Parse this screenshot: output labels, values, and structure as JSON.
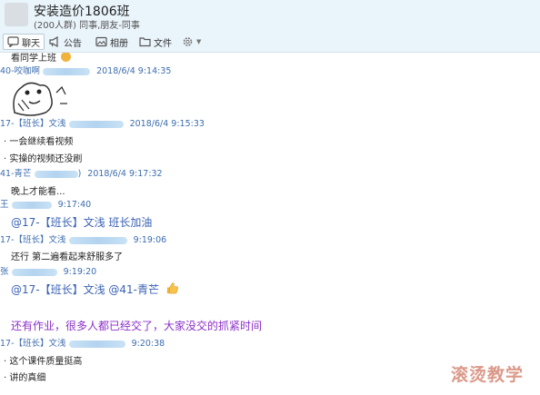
{
  "header": {
    "title": "安装造价1806班",
    "subtitle": "(200人群) 同事,朋友-同事"
  },
  "toolbar": {
    "items": [
      {
        "label": "聊天",
        "icon": "chat-icon"
      },
      {
        "label": "公告",
        "icon": "announcement-icon"
      },
      {
        "label": "相册",
        "icon": "album-icon"
      },
      {
        "label": "文件",
        "icon": "folder-icon"
      },
      {
        "label": "",
        "icon": "gear-icon"
      }
    ]
  },
  "messages": [
    {
      "type": "text",
      "text": "看同学上班"
    },
    {
      "type": "meta",
      "sender": "40-咬咖啊",
      "time": "2018/6/4 9:14:35"
    },
    {
      "type": "meta",
      "sender": "17-【班长】文浅",
      "time": "2018/6/4 9:15:33"
    },
    {
      "type": "text",
      "text": "一会继续看视频"
    },
    {
      "type": "text",
      "text": "实操的视频还没刷"
    },
    {
      "type": "meta",
      "sender": "41-青芒",
      "time": "2018/6/4 9:17:32"
    },
    {
      "type": "text",
      "text": "晚上才能看..."
    },
    {
      "type": "meta",
      "sender": "王",
      "time": "9:17:40"
    },
    {
      "type": "text",
      "text": "@17-【班长】文浅  班长加油"
    },
    {
      "type": "meta",
      "sender": "17-【班长】文浅",
      "time": "9:19:06"
    },
    {
      "type": "text",
      "text": "还行 第二遍看起来舒服多了"
    },
    {
      "type": "meta",
      "sender": "张",
      "time": "9:19:20"
    },
    {
      "type": "text",
      "text": "@17-【班长】文浅 @41-青芒"
    },
    {
      "type": "text",
      "text": "还有作业，很多人都已经交了，大家没交的抓紧时间"
    },
    {
      "type": "meta",
      "sender": "17-【班长】文浅",
      "time": "9:20:38"
    },
    {
      "type": "text",
      "text": "这个课件质量挺高"
    },
    {
      "type": "text",
      "text": "讲的真细"
    }
  ],
  "colors": {
    "header_bg": "#eaf4fb",
    "meta_blue": "#3c6db0",
    "mention_blue": "#3a62b5",
    "purple": "#8b2fc9"
  },
  "watermark": "滚烫教学"
}
